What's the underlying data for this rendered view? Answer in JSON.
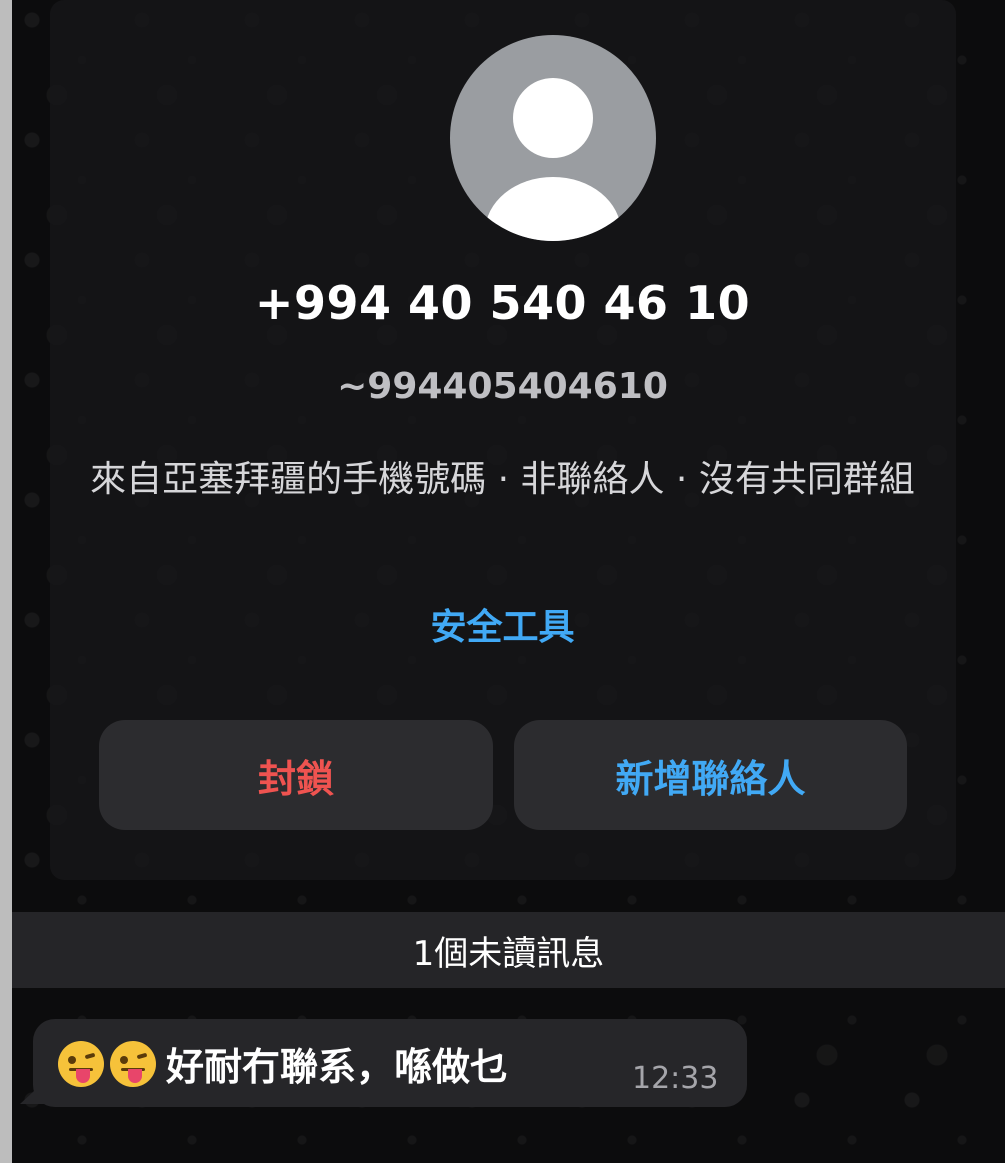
{
  "contact": {
    "phone": "+994 40 540 46 10",
    "username": "~994405404610",
    "description": "來自亞塞拜疆的手機號碼 · 非聯絡人 · 沒有共同群組",
    "safety_tools_label": "安全工具"
  },
  "actions": {
    "block_label": "封鎖",
    "add_contact_label": "新增聯絡人"
  },
  "unread_label": "1個未讀訊息",
  "message": {
    "emoji": [
      "zany-face-emoji",
      "zany-face-emoji"
    ],
    "text": "好耐冇聯系，喺做乜",
    "time": "12:33"
  },
  "colors": {
    "background": "#0c0c0d",
    "link_blue": "#41a9f5",
    "block_red": "#ef5350",
    "button_bg": "#2c2c2f",
    "bubble_bg": "#262629"
  }
}
